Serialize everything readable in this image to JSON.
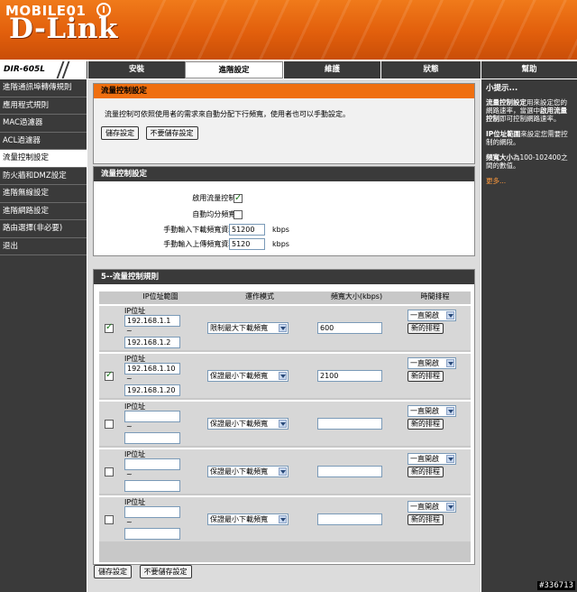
{
  "brand": {
    "site": "MOBILE01",
    "vendor": "D-Link",
    "model": "DIR-605L"
  },
  "tabs": [
    "安裝",
    "進階設定",
    "維護",
    "狀態",
    "幫助"
  ],
  "active_tab": "進階設定",
  "sidebar": {
    "items": [
      "進階通訊埠轉傳規則",
      "應用程式規則",
      "MAC過濾器",
      "ACL過濾器",
      "流量控制設定",
      "防火牆和DMZ設定",
      "進階無線設定",
      "進階網路設定",
      "路由選擇(非必要)",
      "退出"
    ],
    "active": "流量控制設定"
  },
  "intro": {
    "title": "流量控制設定",
    "description": "流量控制可依照使用者的需求來自動分配下行頻寬，使用者也可以手動設定。",
    "save_label": "儲存設定",
    "nosave_label": "不要儲存設定"
  },
  "settings": {
    "title": "流量控制設定",
    "enable_label": "啟用流量控制:",
    "enable_checked": true,
    "auto_label": "自動均分頻寬:",
    "auto_checked": false,
    "down_label": "手動輸入下載頻寬資料:",
    "down_value": "51200",
    "up_label": "手動輸入上傳頻寬資料:",
    "up_value": "5120",
    "unit": "kbps"
  },
  "rules": {
    "title": "5--流量控制規則",
    "headers": [
      "IP位址範圍",
      "運作模式",
      "頻寬大小(kbps)",
      "時間排程"
    ],
    "ip_label": "IP位址",
    "tilde": "~",
    "schedule_btn": "新的排程",
    "rows": [
      {
        "checked": true,
        "ip_start": "192.168.1.1",
        "ip_end": "192.168.1.2",
        "mode": "限制最大下載頻寬",
        "bandwidth": "600",
        "schedule": "一直開啟"
      },
      {
        "checked": true,
        "ip_start": "192.168.1.10",
        "ip_end": "192.168.1.20",
        "mode": "保證最小下載頻寬",
        "bandwidth": "2100",
        "schedule": "一直開啟"
      },
      {
        "checked": false,
        "ip_start": "",
        "ip_end": "",
        "mode": "保證最小下載頻寬",
        "bandwidth": "",
        "schedule": "一直開啟"
      },
      {
        "checked": false,
        "ip_start": "",
        "ip_end": "",
        "mode": "保證最小下載頻寬",
        "bandwidth": "",
        "schedule": "一直開啟"
      },
      {
        "checked": false,
        "ip_start": "",
        "ip_end": "",
        "mode": "保證最小下載頻寬",
        "bandwidth": "",
        "schedule": "一直開啟"
      }
    ]
  },
  "bottom": {
    "save_label": "儲存設定",
    "nosave_label": "不要儲存設定"
  },
  "help": {
    "title": "小提示...",
    "p1_bold1": "流量控制設定",
    "p1_text1": "用來設定您的網路速率，當選中",
    "p1_bold2": "啟用流量控制",
    "p1_text2": "即可控制網路速率。",
    "p2_bold": "IP位址範圍",
    "p2_text": "來設定您需要控制的網段。",
    "p3_bold": "頻寬大小",
    "p3_text": "為100-102400之間的數值。",
    "more": "更多..."
  },
  "watermark": "#336713"
}
